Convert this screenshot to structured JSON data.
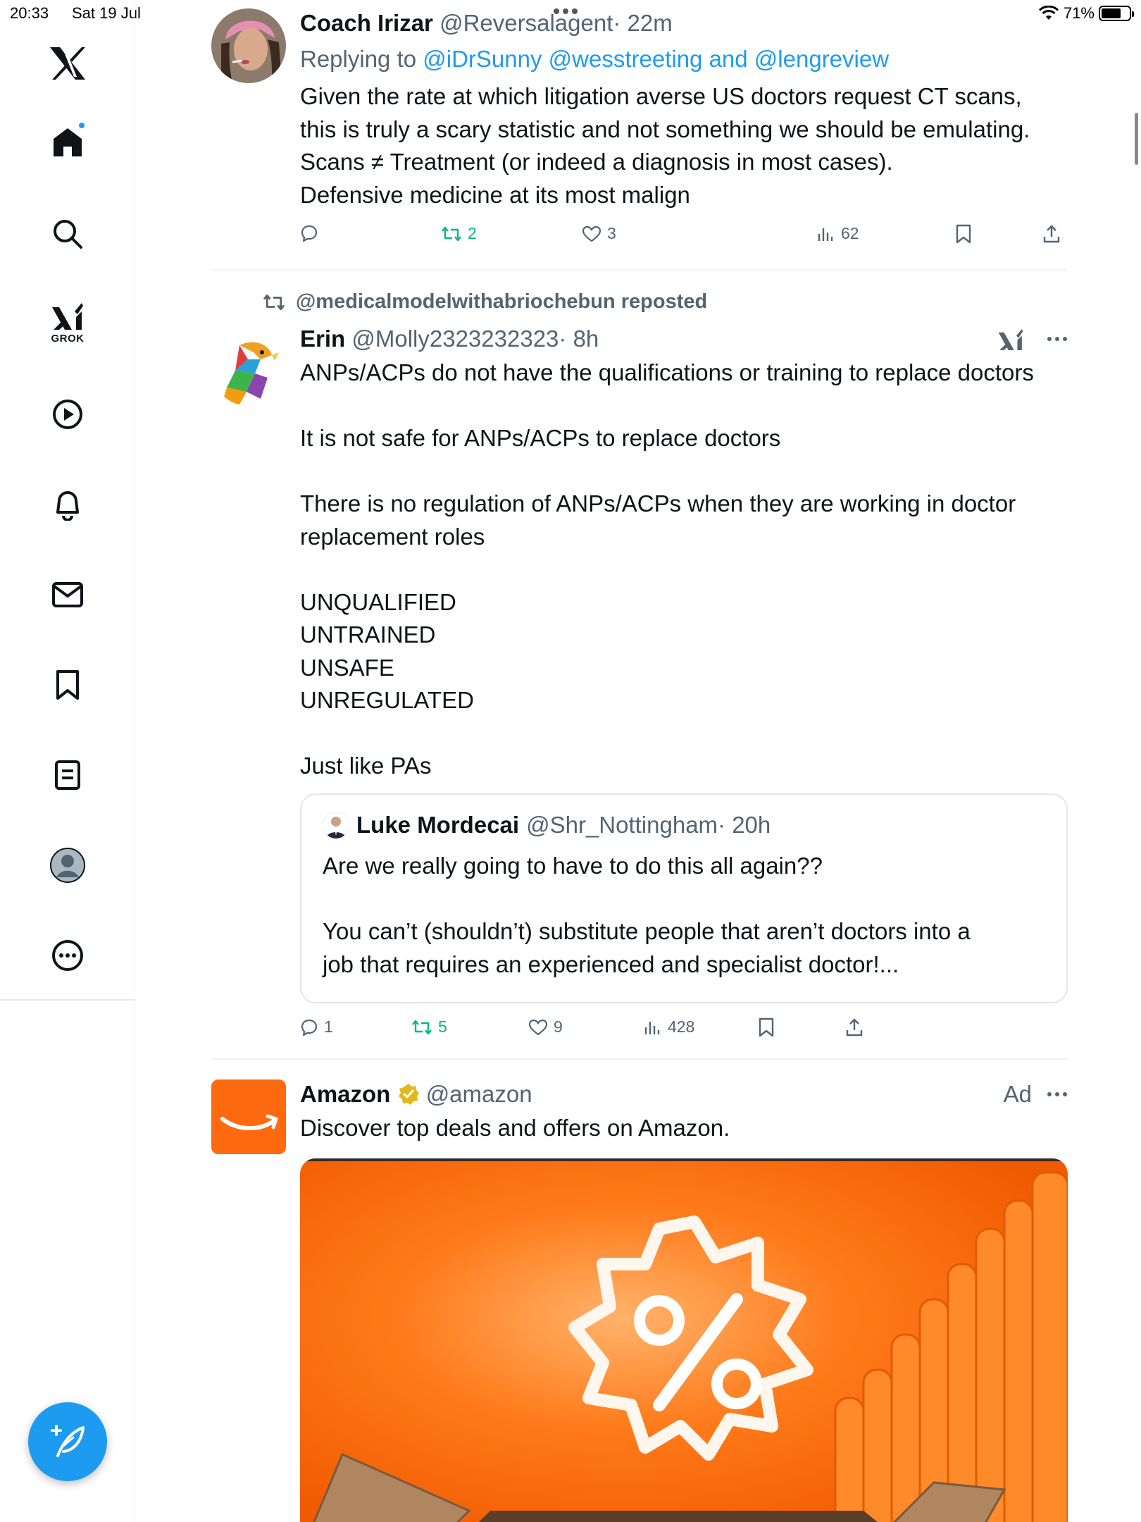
{
  "status_bar": {
    "time": "20:33",
    "date": "Sat 19 Jul",
    "battery": "71%",
    "battery_level": 0.71
  },
  "sidebar": {
    "items": [
      {
        "name": "x-logo",
        "label": ""
      },
      {
        "name": "home",
        "label": ""
      },
      {
        "name": "explore",
        "label": ""
      },
      {
        "name": "grok",
        "label": "GROK"
      },
      {
        "name": "video",
        "label": ""
      },
      {
        "name": "notifications",
        "label": ""
      },
      {
        "name": "messages",
        "label": ""
      },
      {
        "name": "bookmarks",
        "label": ""
      },
      {
        "name": "lists",
        "label": ""
      },
      {
        "name": "profile",
        "label": ""
      },
      {
        "name": "more",
        "label": ""
      }
    ],
    "grok_label": "GROK",
    "accent_color": "#1d9bf0"
  },
  "tweets": [
    {
      "name": "Coach Irizar",
      "handle": "@Reversalagent",
      "time": "· 22m",
      "replying_prefix": "Replying to ",
      "replying_mentions": "@iDrSunny @wesstreeting and @lengreview",
      "text": "Given the rate at which litigation averse US doctors request CT scans,\nthis is truly a scary statistic and not something we should be emulating.\nScans ≠ Treatment (or indeed a diagnosis in most cases).\nDefensive medicine at its most malign",
      "replies": "",
      "reposts": "2",
      "likes": "3",
      "views": "62"
    },
    {
      "reposted_by": "@medicalmodelwithabriochebun reposted",
      "name": "Erin",
      "handle": "@Molly2323232323",
      "time": "· 8h",
      "text": "ANPs/ACPs do not have the qualifications or training to replace doctors\n\nIt is not safe for ANPs/ACPs to replace doctors\n\nThere is no regulation of ANPs/ACPs when they are working in doctor\nreplacement roles\n\nUNQUALIFIED\nUNTRAINED\nUNSAFE\nUNREGULATED\n\nJust like PAs",
      "quote": {
        "name": "Luke Mordecai",
        "handle": "@Shr_Nottingham",
        "time": "· 20h",
        "text": "Are we really going to have to do this all again??\n\nYou can’t (shouldn’t) substitute people that aren’t doctors into a\njob that requires an experienced and specialist doctor!..."
      },
      "replies": "1",
      "reposts": "5",
      "likes": "9",
      "views": "428"
    },
    {
      "name": "Amazon",
      "handle": "@amazon",
      "ad_label": "Ad",
      "text": "Discover top deals and offers on Amazon.",
      "brand_color": "#ff6a10",
      "verified_color": "#e2b719"
    }
  ]
}
